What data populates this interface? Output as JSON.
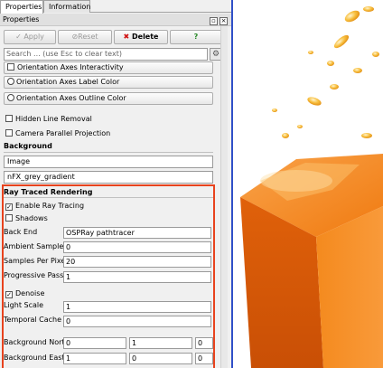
{
  "tabs": [
    "Properties",
    "Information"
  ],
  "panel_title": "Properties",
  "toolbar": {
    "apply": "Apply",
    "reset": "Reset",
    "delete": "Delete",
    "help": "?"
  },
  "search": {
    "placeholder": "Search ... (use Esc to clear text)"
  },
  "rows": {
    "orientation_interactivity": "Orientation Axes Interactivity",
    "label_color": "Orientation Axes Label Color",
    "outline_color": "Orientation Axes Outline Color",
    "hidden_line_removal": "Hidden Line Removal",
    "camera_parallel": "Camera Parallel Projection"
  },
  "background": {
    "title": "Background",
    "type": "Image",
    "image_name": "nFX_grey_gradient"
  },
  "ray_traced": {
    "title": "Ray Traced Rendering",
    "enable_label": "Enable Ray Tracing",
    "enable_checked": true,
    "shadows_label": "Shadows",
    "shadows_checked": false,
    "back_end_label": "Back End",
    "back_end_value": "OSPRay pathtracer",
    "ambient_label": "Ambient Samples",
    "ambient_value": "0",
    "spp_label": "Samples Per Pixel",
    "spp_value": "20",
    "progressive_label": "Progressive Passes",
    "progressive_value": "1",
    "denoise_label": "Denoise",
    "denoise_checked": true,
    "light_scale_label": "Light Scale",
    "light_scale_value": "1",
    "temporal_label": "Temporal Cache Size",
    "temporal_value": "0",
    "bg_north_label": "Background North",
    "bg_north": [
      "0",
      "1",
      "0"
    ],
    "bg_east_label": "Background East",
    "bg_east": [
      "1",
      "0",
      "0"
    ]
  },
  "colors": {
    "highlight_border": "#e8431e",
    "viewport_divider": "#3050c8",
    "cube_orange": "#f47a12"
  }
}
